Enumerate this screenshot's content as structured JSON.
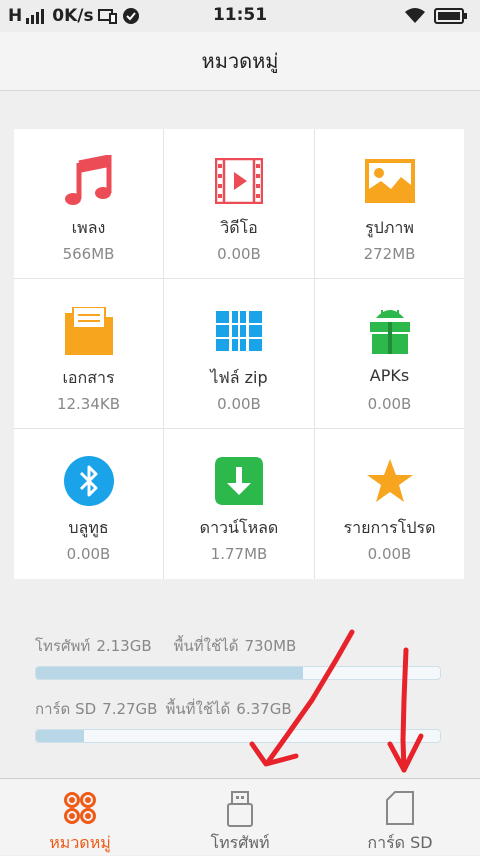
{
  "status_bar": {
    "signal": "H",
    "speed": "0K/s",
    "time": "11:51"
  },
  "title": "หมวดหมู่",
  "categories": [
    {
      "label": "เพลง",
      "size": "566MB",
      "icon": "music-note-icon"
    },
    {
      "label": "วิดีโอ",
      "size": "0.00B",
      "icon": "video-film-icon"
    },
    {
      "label": "รูปภาพ",
      "size": "272MB",
      "icon": "image-icon"
    },
    {
      "label": "เอกสาร",
      "size": "12.34KB",
      "icon": "document-folder-icon"
    },
    {
      "label": "ไฟล์ zip",
      "size": "0.00B",
      "icon": "zip-archive-icon"
    },
    {
      "label": "APKs",
      "size": "0.00B",
      "icon": "android-apk-icon"
    },
    {
      "label": "บลูทูธ",
      "size": "0.00B",
      "icon": "bluetooth-icon"
    },
    {
      "label": "ดาวน์โหลด",
      "size": "1.77MB",
      "icon": "download-icon"
    },
    {
      "label": "รายการโปรด",
      "size": "0.00B",
      "icon": "star-icon"
    }
  ],
  "storage": {
    "phone": {
      "label": "โทรศัพท์",
      "total": "2.13GB",
      "free_label": "พื้นที่ใช้ได้",
      "free": "730MB",
      "used_fraction": 0.66
    },
    "sd": {
      "label": "การ์ด SD",
      "total": "7.27GB",
      "free_label": "พื้นที่ใช้ได้",
      "free": "6.37GB",
      "used_fraction": 0.12
    }
  },
  "bottom_nav": [
    {
      "label": "หมวดหมู่",
      "icon": "category-grid-icon",
      "active": true
    },
    {
      "label": "โทรศัพท์",
      "icon": "usb-phone-icon",
      "active": false
    },
    {
      "label": "การ์ด SD",
      "icon": "sd-card-icon",
      "active": false
    }
  ],
  "colors": {
    "accent": "#ee5a17",
    "annotation_arrow": "#e8222a"
  }
}
